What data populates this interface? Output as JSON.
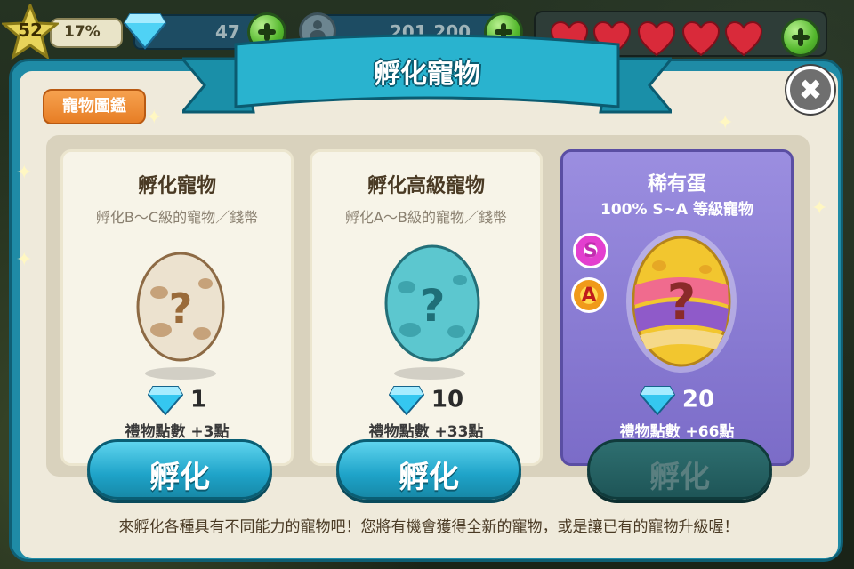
{
  "hud": {
    "level": "52",
    "xp_percent": "17%",
    "gems": "47",
    "coins": "201,200",
    "hearts": [
      1,
      1,
      1,
      1,
      1
    ]
  },
  "panel": {
    "title": "孵化寵物",
    "catalog_button": "寵物圖鑑",
    "close_label": "✖",
    "footer": "來孵化各種具有不同能力的寵物吧！您將有機會獲得全新的寵物，或是讓已有的寵物升級喔！"
  },
  "cards": [
    {
      "title": "孵化寵物",
      "subtitle": "孵化B～C級的寵物／錢幣",
      "price": "1",
      "points": "禮物點數 +3點",
      "button": "孵化",
      "egg_color": "#e8dcc8",
      "egg_spots": "#b08a5e",
      "question_color": "#9a6b3a"
    },
    {
      "title": "孵化高級寵物",
      "subtitle": "孵化A～B級的寵物／錢幣",
      "price": "10",
      "points": "禮物點數 +33點",
      "button": "孵化",
      "egg_color": "#5cc7cf",
      "egg_spots": "#2f8f99",
      "question_color": "#1f6f78"
    },
    {
      "title": "稀有蛋",
      "subtitle": "100% S~A 等級寵物",
      "price": "20",
      "points": "禮物點數 +66點",
      "button": "孵化",
      "badge_s": "S",
      "badge_a": "A"
    }
  ],
  "colors": {
    "panel": "#1f8ba6",
    "hatch_button": "#1ea3c8",
    "rare_card": "#8d7fd6",
    "diamond": "#35c7f0"
  }
}
